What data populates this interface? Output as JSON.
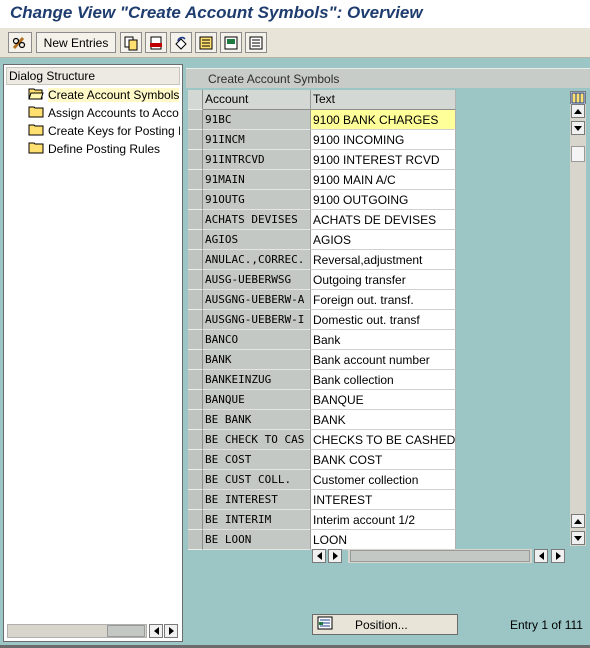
{
  "window": {
    "title": "Change View \"Create Account Symbols\": Overview"
  },
  "toolbar": {
    "new_entries_label": "New Entries"
  },
  "dialog_structure": {
    "header": "Dialog Structure",
    "items": [
      {
        "label": "Create Account Symbols",
        "selected": true,
        "open": true
      },
      {
        "label": "Assign Accounts to Acco",
        "selected": false,
        "open": false
      },
      {
        "label": "Create Keys for Posting I",
        "selected": false,
        "open": false
      },
      {
        "label": "Define Posting Rules",
        "selected": false,
        "open": false
      }
    ]
  },
  "table": {
    "section_title": "Create Account Symbols",
    "columns": [
      "Account",
      "Text"
    ],
    "rows": [
      {
        "account": "91BC",
        "text": "9100 BANK CHARGES"
      },
      {
        "account": "91INCM",
        "text": "9100 INCOMING"
      },
      {
        "account": "91INTRCVD",
        "text": "9100 INTEREST RCVD"
      },
      {
        "account": "91MAIN",
        "text": "9100 MAIN A/C"
      },
      {
        "account": "91OUTG",
        "text": "9100 OUTGOING"
      },
      {
        "account": "ACHATS DEVISES",
        "text": "ACHATS DE DEVISES"
      },
      {
        "account": "AGIOS",
        "text": "AGIOS"
      },
      {
        "account": "ANULAC.,CORREC.",
        "text": "Reversal,adjustment"
      },
      {
        "account": "AUSG-UEBERWSG",
        "text": "Outgoing transfer"
      },
      {
        "account": "AUSGNG-UEBERW-A",
        "text": "Foreign out. transf."
      },
      {
        "account": "AUSGNG-UEBERW-I",
        "text": "Domestic out. transf"
      },
      {
        "account": "BANCO",
        "text": "Bank"
      },
      {
        "account": "BANK",
        "text": "Bank account number"
      },
      {
        "account": "BANKEINZUG",
        "text": "Bank collection"
      },
      {
        "account": "BANQUE",
        "text": "BANQUE"
      },
      {
        "account": "BE BANK",
        "text": "BANK"
      },
      {
        "account": "BE CHECK TO CAS",
        "text": "CHECKS TO BE CASHED"
      },
      {
        "account": "BE COST",
        "text": "BANK COST"
      },
      {
        "account": "BE CUST COLL.",
        "text": "Customer collection"
      },
      {
        "account": "BE INTEREST",
        "text": "INTEREST"
      },
      {
        "account": "BE INTERIM",
        "text": "Interim account 1/2"
      },
      {
        "account": "BE LOON",
        "text": "LOON"
      }
    ]
  },
  "footer": {
    "position_label": "Position...",
    "entry_info": "Entry 1 of 111"
  },
  "colors": {
    "background": "#9cc6c6",
    "title": "#1e3c6e",
    "selected_cell": "#ffff99"
  }
}
